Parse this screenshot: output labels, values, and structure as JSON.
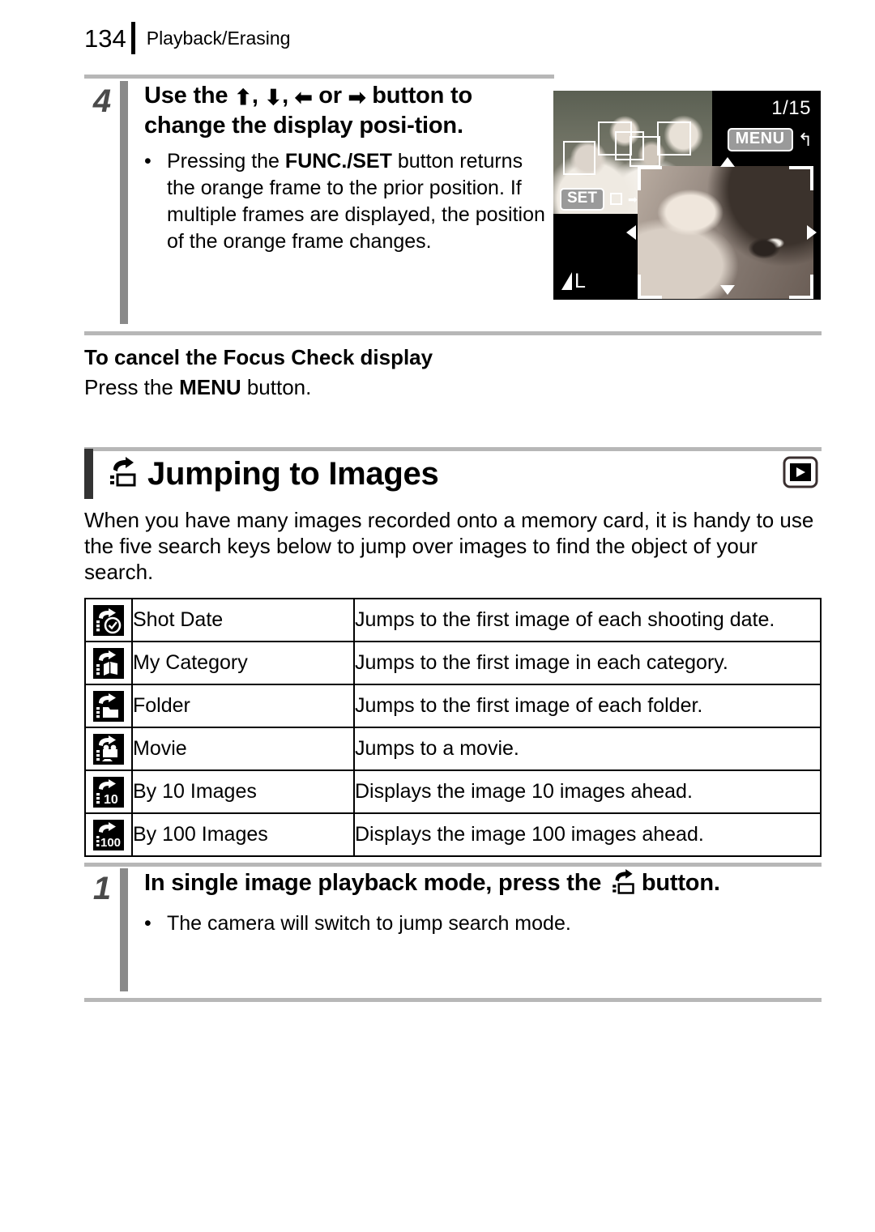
{
  "header": {
    "page_number": "134",
    "section_title": "Playback/Erasing"
  },
  "step4": {
    "number": "4",
    "title_part1": "Use the ",
    "arrow_up": "⬆",
    "comma1": ", ",
    "arrow_down": "⬇",
    "comma2": ", ",
    "arrow_left": "⬅",
    "or_text": " or ",
    "arrow_right": "➡",
    "title_part2": " button to change the display posi-tion.",
    "bullet_dot": "•",
    "bullet_text_a": "Pressing the ",
    "bullet_bold": "FUNC./SET",
    "bullet_text_b": " button returns the orange frame to the prior position. If multiple frames are displayed, the position of the orange frame changes."
  },
  "lcd": {
    "counter": "1/15",
    "menu_label": "MENU",
    "return_arrow": "↰",
    "set_label": "SET",
    "set_arrow": "➡",
    "quality_label": "L"
  },
  "cancel_section": {
    "title": "To cancel the Focus Check display",
    "text_a": "Press the ",
    "text_bold": "MENU",
    "text_b": " button."
  },
  "section": {
    "title": "Jumping to Images",
    "left_icon": "jump-icon",
    "right_icon": "playback-mode-icon"
  },
  "intro": "When you have many images recorded onto a memory card, it is handy to use the five search keys below to jump over images to find the object of your search.",
  "table": {
    "rows": [
      {
        "icon": "jump-shot-date-icon",
        "name": "Shot Date",
        "desc": "Jumps to the first image of each shooting date."
      },
      {
        "icon": "jump-my-category-icon",
        "name": "My Category",
        "desc": "Jumps to the first image in each category."
      },
      {
        "icon": "jump-folder-icon",
        "name": "Folder",
        "desc": "Jumps to the first image of each folder."
      },
      {
        "icon": "jump-movie-icon",
        "name": "Movie",
        "desc": "Jumps to a movie."
      },
      {
        "icon": "jump-by-10-images-icon",
        "name": "By 10 Images",
        "desc": "Displays the image 10 images ahead."
      },
      {
        "icon": "jump-by-100-images-icon",
        "name": "By 100 Images",
        "desc": "Displays the image 100 images ahead."
      }
    ],
    "icon_labels": {
      "by10": "10",
      "by100": "100"
    }
  },
  "step1": {
    "number": "1",
    "title_a": "In single image playback mode, press the ",
    "title_b": " button.",
    "bullet_dot": "•",
    "bullet_text": "The camera will switch to jump search mode."
  },
  "colors": {
    "rule_gray": "#b7b7b7",
    "step_bar_gray": "#8a8a8a",
    "step_num_gray": "#4a4a4a",
    "section_bar": "#333333",
    "badge_gray": "#9a9a9a"
  }
}
